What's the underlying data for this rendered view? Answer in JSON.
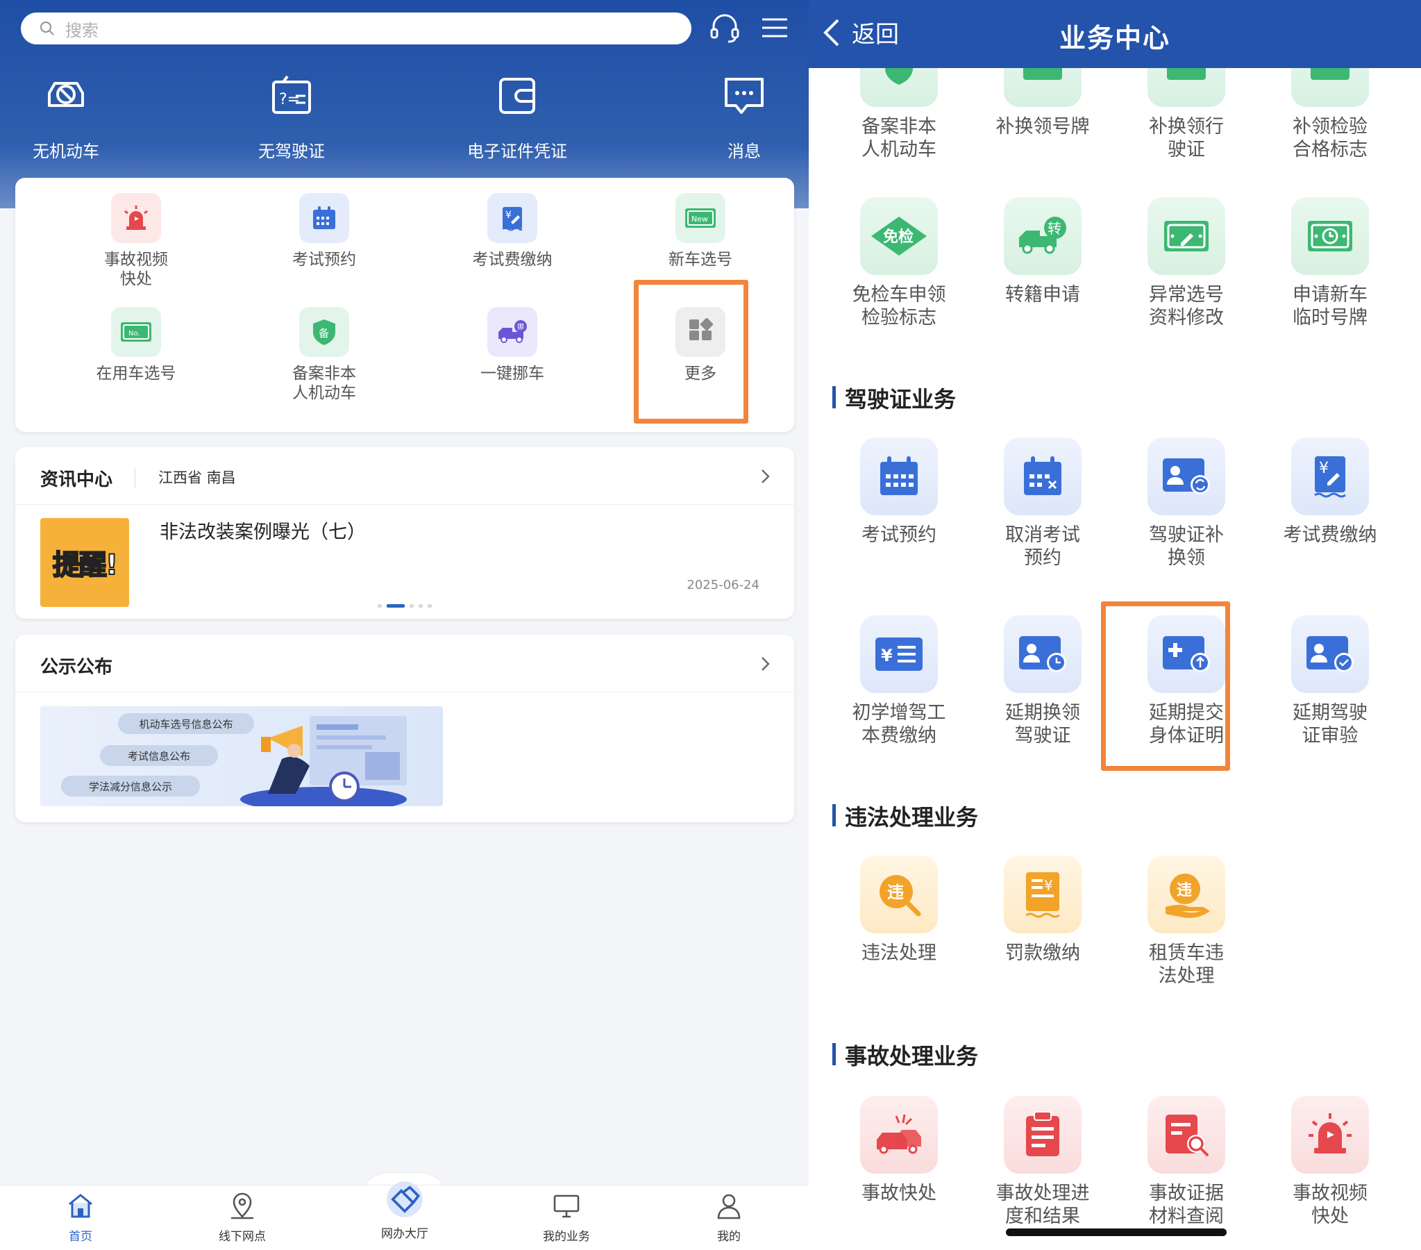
{
  "left": {
    "search": {
      "placeholder": "搜索"
    },
    "quick_actions": [
      {
        "label": "无机动车",
        "icon": "car-off-icon"
      },
      {
        "label": "无驾驶证",
        "icon": "license-off-icon"
      },
      {
        "label": "电子证件凭证",
        "icon": "wallet-icon"
      },
      {
        "label": "消息",
        "icon": "message-icon"
      }
    ],
    "grid": [
      {
        "label": "事故视频\n快处",
        "icon": "alarm-icon"
      },
      {
        "label": "考试预约",
        "icon": "calendar-icon"
      },
      {
        "label": "考试费缴纳",
        "icon": "fee-icon"
      },
      {
        "label": "新车选号",
        "icon": "new-plate-icon"
      },
      {
        "label": "在用车选号",
        "icon": "plate-icon"
      },
      {
        "label": "备案非本\n人机动车",
        "icon": "shield-icon"
      },
      {
        "label": "一键挪车",
        "icon": "tow-truck-icon"
      },
      {
        "label": "更多",
        "icon": "more-icon"
      }
    ],
    "news": {
      "title": "资讯中心",
      "location": "江西省 南昌",
      "thumb_text": "提醒!",
      "headline": "非法改装案例曝光（七）",
      "date": "2025-06-24"
    },
    "notice": {
      "title": "公示公布",
      "pills": [
        "机动车选号信息公布",
        "考试信息公布",
        "学法减分信息公示"
      ]
    },
    "bottom_nav": [
      {
        "label": "首页",
        "icon": "home-icon",
        "active": true
      },
      {
        "label": "线下网点",
        "icon": "location-icon"
      },
      {
        "label": "网办大厅",
        "icon": "handshake-icon"
      },
      {
        "label": "我的业务",
        "icon": "monitor-icon"
      },
      {
        "label": "我的",
        "icon": "user-icon"
      }
    ]
  },
  "right": {
    "back_label": "返回",
    "title": "业务中心",
    "vehicle_items": [
      {
        "label": "备案非本\n人机动车"
      },
      {
        "label": "补换领号牌"
      },
      {
        "label": "补换领行\n驶证"
      },
      {
        "label": "补领检验\n合格标志"
      },
      {
        "label": "免检车申领\n检验标志",
        "icon_text": "免检"
      },
      {
        "label": "转籍申请",
        "icon_text": "转"
      },
      {
        "label": "异常选号\n资料修改"
      },
      {
        "label": "申请新车\n临时号牌"
      }
    ],
    "sections": {
      "license": "驾驶证业务",
      "violation": "违法处理业务",
      "accident": "事故处理业务"
    },
    "license_items": [
      {
        "label": "考试预约"
      },
      {
        "label": "取消考试\n预约"
      },
      {
        "label": "驾驶证补\n换领"
      },
      {
        "label": "考试费缴纳"
      },
      {
        "label": "初学增驾工\n本费缴纳"
      },
      {
        "label": "延期换领\n驾驶证"
      },
      {
        "label": "延期提交\n身体证明"
      },
      {
        "label": "延期驾驶\n证审验"
      }
    ],
    "violation_items": [
      {
        "label": "违法处理",
        "icon_text": "违"
      },
      {
        "label": "罚款缴纳"
      },
      {
        "label": "租赁车违\n法处理",
        "icon_text": "违"
      }
    ],
    "accident_items": [
      {
        "label": "事故快处"
      },
      {
        "label": "事故处理进\n度和结果"
      },
      {
        "label": "事故证据\n材料查阅"
      },
      {
        "label": "事故视频\n快处"
      }
    ]
  },
  "colors": {
    "primary": "#2353ab",
    "highlight": "#f2853b",
    "green": "#3cb872",
    "blue": "#3a6fd8",
    "orange": "#f2a32a",
    "red": "#e5484d"
  }
}
